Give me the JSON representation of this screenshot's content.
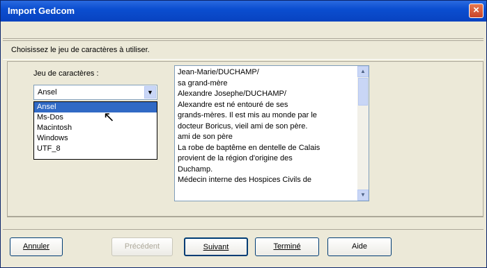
{
  "window": {
    "title": "Import Gedcom",
    "close_label": "×"
  },
  "instruction": "Choisissez le jeu de caractères à utiliser.",
  "charset": {
    "label": "Jeu de caractères :",
    "selected": "Ansel",
    "options": [
      "Ansel",
      "Ms-Dos",
      "Macintosh",
      "Windows",
      "UTF_8"
    ],
    "highlighted_index": 0
  },
  "notes": {
    "lines": [
      "Jean-Marie/DUCHAMP/",
      "sa grand-mère",
      "Alexandre Josephe/DUCHAMP/",
      "Alexandre est né entouré de ses",
      "grands-mères. Il est mis au monde par le",
      "docteur Boricus, vieil ami de son père.",
      "ami de son père",
      "La robe de baptême en dentelle de Calais",
      "provient de la région d'origine des",
      "Duchamp.",
      "Médecin interne des Hospices Civils de"
    ]
  },
  "buttons": {
    "cancel": "Annuler",
    "previous": "Précédent",
    "next": "Suivant",
    "finish": "Terminé",
    "help": "Aide"
  }
}
